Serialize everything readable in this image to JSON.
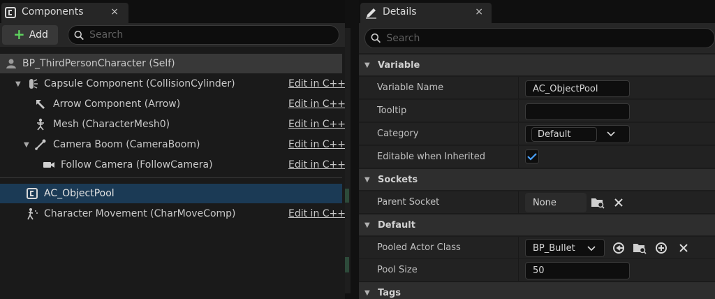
{
  "components_panel": {
    "tab_title": "Components",
    "close_glyph": "×",
    "add_label": "Add",
    "search_placeholder": "Search",
    "root_item": "BP_ThirdPersonCharacter (Self)",
    "items": [
      {
        "label": "Capsule Component (CollisionCylinder)",
        "edit": "Edit in C++"
      },
      {
        "label": "Arrow Component (Arrow)",
        "edit": "Edit in C++"
      },
      {
        "label": "Mesh (CharacterMesh0)",
        "edit": "Edit in C++"
      },
      {
        "label": "Camera Boom (CameraBoom)",
        "edit": "Edit in C++"
      },
      {
        "label": "Follow Camera (FollowCamera)",
        "edit": "Edit in C++"
      }
    ],
    "selected_item": "AC_ObjectPool",
    "movement_item": {
      "label": "Character Movement (CharMoveComp)",
      "edit": "Edit in C++"
    }
  },
  "details_panel": {
    "tab_title": "Details",
    "close_glyph": "×",
    "search_placeholder": "Search",
    "categories": {
      "variable": "Variable",
      "sockets": "Sockets",
      "default": "Default",
      "tags": "Tags"
    },
    "properties": {
      "variable_name": {
        "label": "Variable Name",
        "value": "AC_ObjectPool"
      },
      "tooltip": {
        "label": "Tooltip",
        "value": ""
      },
      "category": {
        "label": "Category",
        "value": "Default"
      },
      "editable": {
        "label": "Editable when Inherited",
        "checked": true
      },
      "parent_socket": {
        "label": "Parent Socket",
        "value": "None"
      },
      "pooled_actor_class": {
        "label": "Pooled Actor Class",
        "value": "BP_Bullet"
      },
      "pool_size": {
        "label": "Pool Size",
        "value": "50"
      }
    }
  },
  "colors": {
    "accent_blue": "#1b3a55",
    "add_green": "#5fd35f",
    "check_blue": "#4aa3ff"
  }
}
